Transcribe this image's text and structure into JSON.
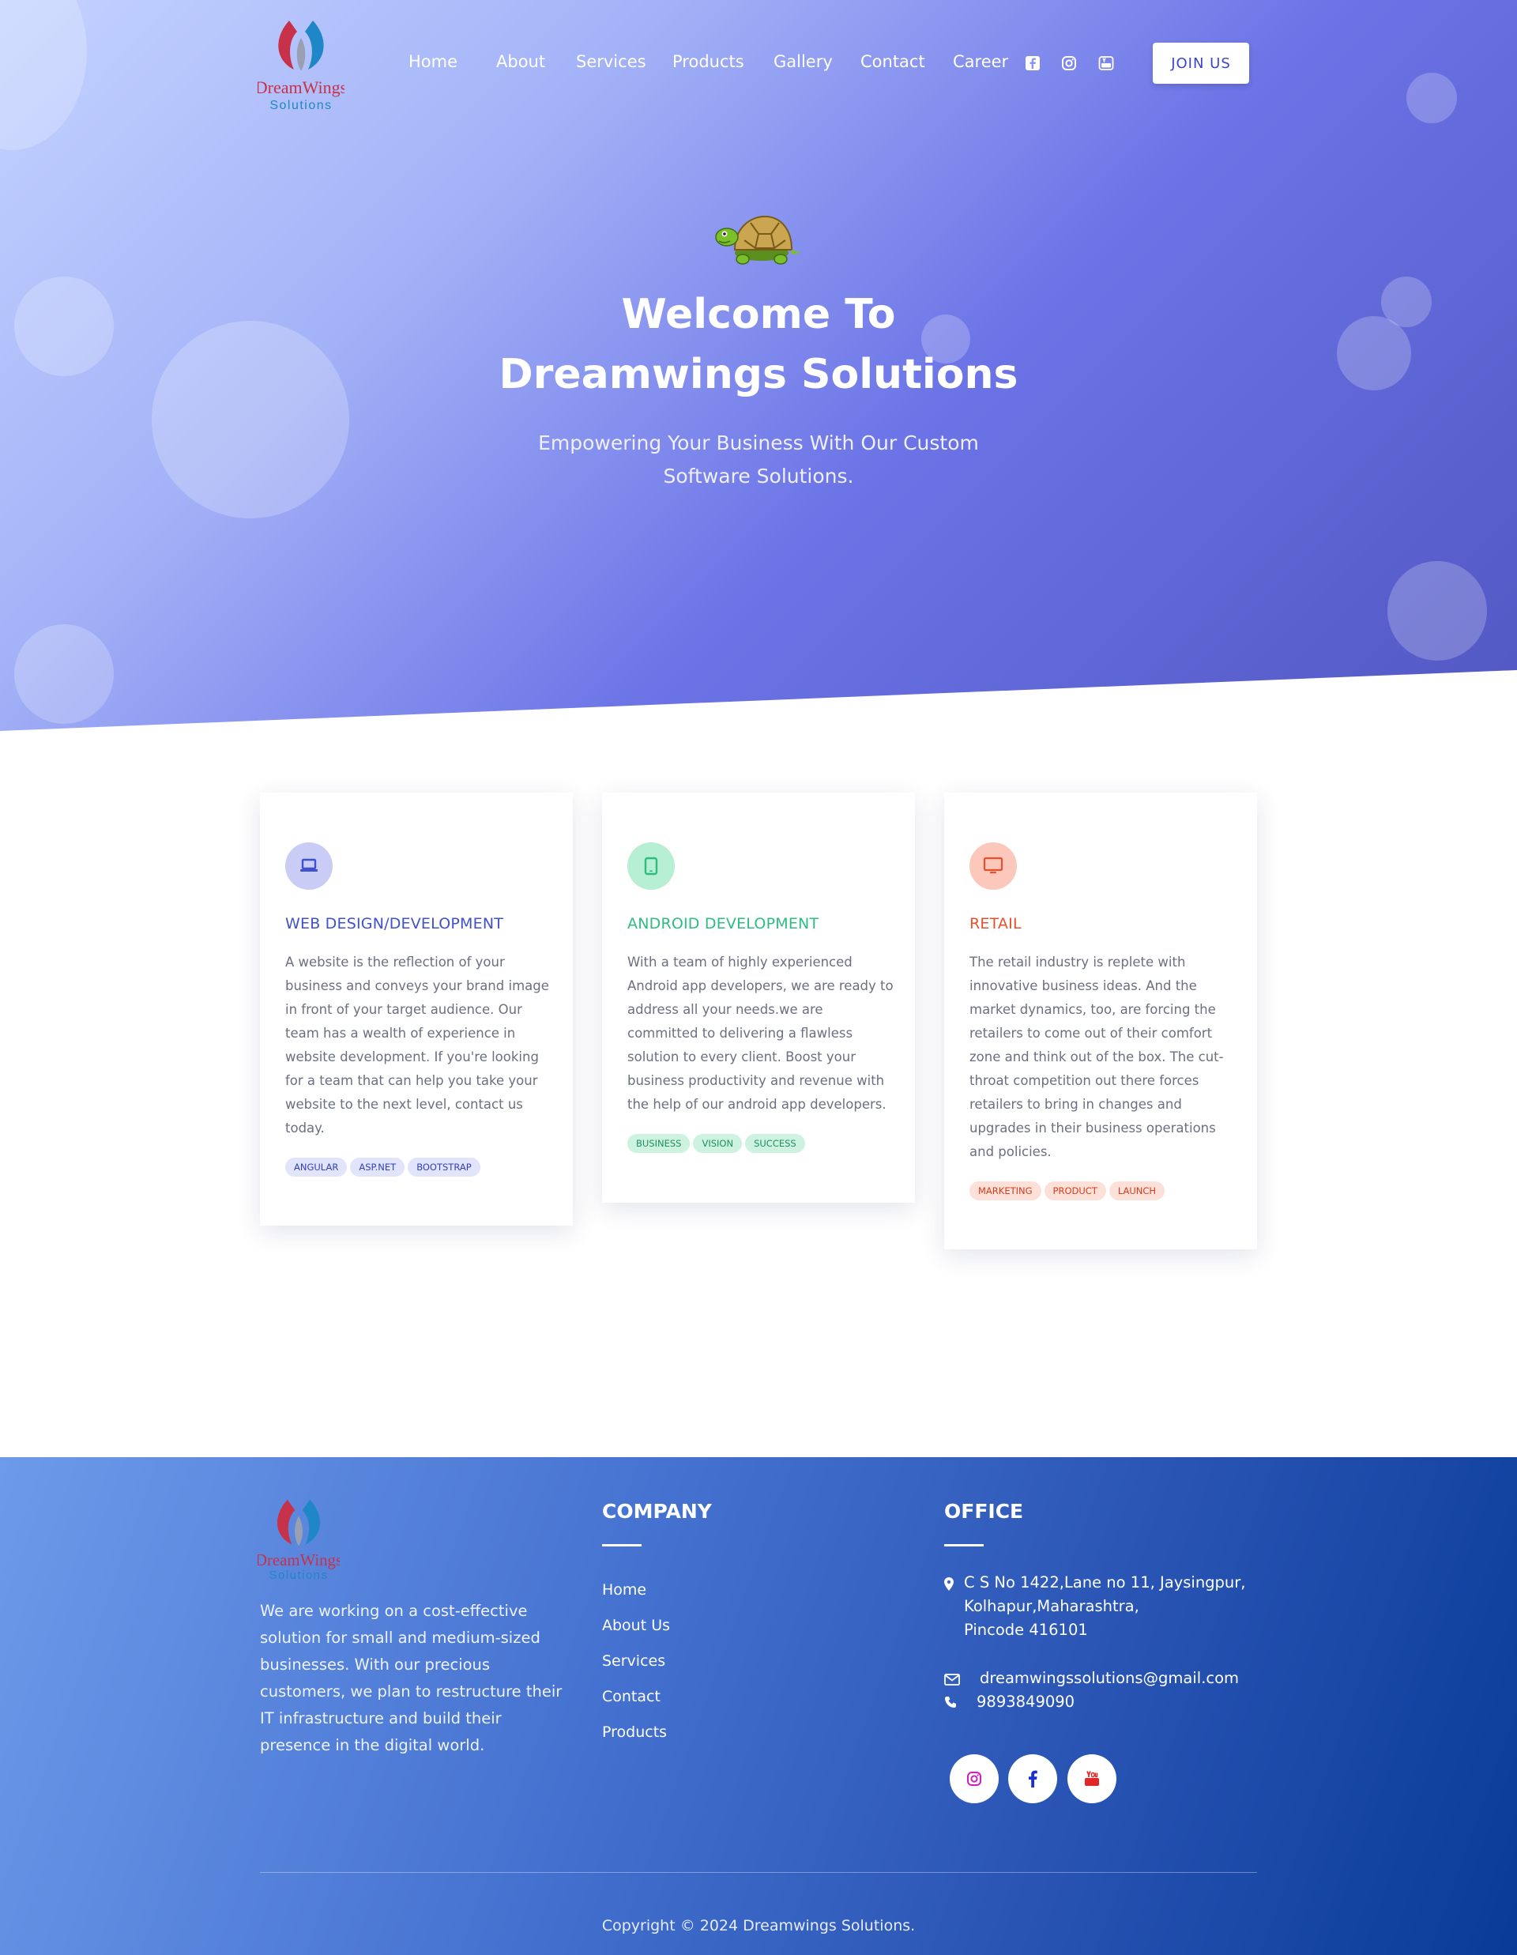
{
  "brand": {
    "logo_primary": "DreamWings",
    "logo_secondary": "Solutions"
  },
  "nav": {
    "items": [
      "Home",
      "About",
      "Services",
      "Products",
      "Gallery",
      "Contact",
      "Career"
    ],
    "social_icons": [
      "facebook-icon",
      "instagram-icon",
      "youtube-icon"
    ],
    "join_label": "JOIN US"
  },
  "hero": {
    "title_line1": "Welcome To",
    "title_line2": "Dreamwings Solutions",
    "subtitle_line1": "Empowering Your Business With Our Custom",
    "subtitle_line2": "Software Solutions."
  },
  "cards": [
    {
      "icon": "laptop-icon",
      "title": "WEB DESIGN/DEVELOPMENT",
      "text": "A website is the reflection of your business and conveys your brand image in front of your target audience. Our team has a wealth of experience in website development. If you're looking for a team that can help you take your website to the next level, contact us today.",
      "tags": [
        "ANGULAR",
        "ASP.NET",
        "BOOTSTRAP"
      ],
      "accent": "#4051cf",
      "icon_bg": "#c9cdf5",
      "tag_bg": "#e1e4fa",
      "tag_fg": "#3340b8"
    },
    {
      "icon": "tablet-icon",
      "title": "ANDROID DEVELOPMENT",
      "text": "With a team of highly experienced Android app developers, we are ready to address all your needs.we are committed to delivering a flawless solution to every client. Boost your business productivity and revenue with the help of our android app developers.",
      "tags": [
        "BUSINESS",
        "VISION",
        "SUCCESS"
      ],
      "accent": "#2dbd7e",
      "icon_bg": "#b6efd3",
      "tag_bg": "#cdf3e0",
      "tag_fg": "#1f8f5e"
    },
    {
      "icon": "monitor-icon",
      "title": "RETAIL",
      "text": "The retail industry is replete with innovative business ideas. And the market dynamics, too, are forcing the retailers to come out of their comfort zone and think out of the box. The cut-throat competition out there forces retailers to bring in changes and upgrades in their business operations and policies.",
      "tags": [
        "MARKETING",
        "PRODUCT",
        "LAUNCH"
      ],
      "accent": "#e8502c",
      "icon_bg": "#fbc8bb",
      "tag_bg": "#fde0d8",
      "tag_fg": "#d23d1b"
    }
  ],
  "footer": {
    "about": "We are working on a cost-effective solution for small and medium-sized businesses. With our precious customers, we plan to restructure their IT infrastructure and build their presence in the digital world.",
    "company_heading": "COMPANY",
    "company_links": [
      "Home",
      "About Us",
      "Services",
      "Contact",
      "Products"
    ],
    "office_heading": "OFFICE",
    "address_line1": "C S No 1422,Lane no 11, Jaysingpur,",
    "address_line2": "Kolhapur,Maharashtra,",
    "address_line3": "Pincode 416101",
    "email": "dreamwingssolutions@gmail.com",
    "phone": "9893849090",
    "social_icons": [
      "instagram-icon",
      "facebook-icon",
      "youtube-icon"
    ],
    "copyright": "Copyright © 2024 Dreamwings Solutions."
  }
}
